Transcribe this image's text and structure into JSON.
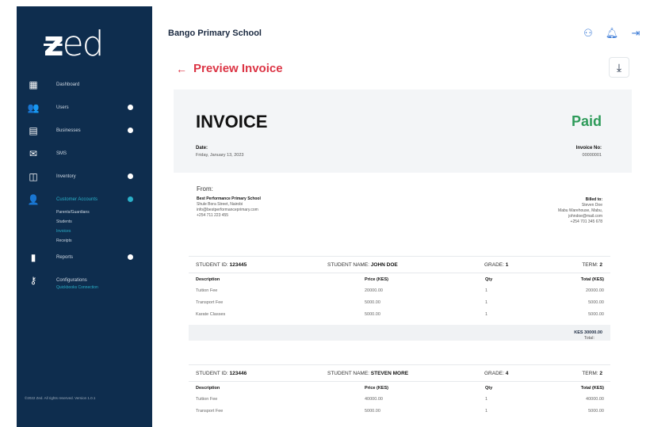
{
  "sidebar": {
    "logo": "zed",
    "items": [
      {
        "label": "Dashboard",
        "icon": "grid-icon",
        "dot": false
      },
      {
        "label": "Users",
        "icon": "users-icon",
        "dot": true
      },
      {
        "label": "Businesses",
        "icon": "building-icon",
        "dot": true
      },
      {
        "label": "SMS",
        "icon": "mail-icon",
        "dot": false
      },
      {
        "label": "Inventory",
        "icon": "box-icon",
        "dot": true
      },
      {
        "label": "Customer Accounts",
        "icon": "customers-icon",
        "dot": true,
        "active": true
      },
      {
        "label": "Reports",
        "icon": "report-icon",
        "dot": true
      },
      {
        "label": "Configurations",
        "icon": "key-icon",
        "dot": false
      }
    ],
    "customer_sub": [
      "Parents/Guardians",
      "Students",
      "Invoices",
      "Receipts"
    ],
    "config_sub": "Quickbooks Connection",
    "footer": "©2022 Zed. All rights reserved.  Version 1.0.1"
  },
  "header": {
    "school_name": "Bango Primary School",
    "icons": [
      "user-icon",
      "bell-icon",
      "logout-icon"
    ]
  },
  "page": {
    "back_icon": "arrow-left-icon",
    "title": "Preview Invoice",
    "download_icon": "download-icon"
  },
  "invoice": {
    "title": "INVOICE",
    "status": "Paid",
    "date_label": "Date:",
    "date_value": "Friday, January 13, 2023",
    "number_label": "Invoice No:",
    "number_value": "00000001"
  },
  "from": {
    "label": "From:",
    "name": "Best Performance Primary School",
    "address": "Shule Bora Street, Nairobi",
    "email": "info@bestperformanceprimary.com",
    "phone": "+254 711 223 455"
  },
  "billed": {
    "label": "Billed to:",
    "name": "Steven Doe",
    "address": "Mabu Warehouse, Mabu,",
    "email": "johndoe@mail.com",
    "phone": "+254 701 345 678"
  },
  "table_headers": {
    "description": "Description",
    "price": "Price (KES)",
    "qty": "Qty",
    "total": "Total (KES)"
  },
  "students": [
    {
      "id_label": "STUDENT ID:",
      "id_value": "123445",
      "name_label": "STUDENT NAME:",
      "name_value": "JOHN DOE",
      "grade_label": "GRADE:",
      "grade_value": "1",
      "term_label": "TERM:",
      "term_value": "2",
      "rows": [
        {
          "desc": "Tuition Fee",
          "price": "20000.00",
          "qty": "1",
          "total": "20000.00"
        },
        {
          "desc": "Transport Fee",
          "price": "5000.00",
          "qty": "1",
          "total": "5000.00"
        },
        {
          "desc": "Karate Classes",
          "price": "5000.00",
          "qty": "1",
          "total": "5000.00"
        }
      ],
      "total_label": "Total:",
      "total_value": "KES 30000.00"
    },
    {
      "id_label": "STUDENT ID:",
      "id_value": "123446",
      "name_label": "STUDENT NAME:",
      "name_value": "STEVEN MORE",
      "grade_label": "GRADE:",
      "grade_value": "4",
      "term_label": "TERM:",
      "term_value": "2",
      "rows": [
        {
          "desc": "Tuition Fee",
          "price": "40000.00",
          "qty": "1",
          "total": "40000.00"
        },
        {
          "desc": "Transport Fee",
          "price": "5000.00",
          "qty": "1",
          "total": "5000.00"
        }
      ]
    }
  ],
  "colors": {
    "sidebar_bg": "#0e2d4e",
    "accent_active": "#2ab0c9",
    "title_red": "#dc3545",
    "paid_green": "#2e9b5a"
  }
}
